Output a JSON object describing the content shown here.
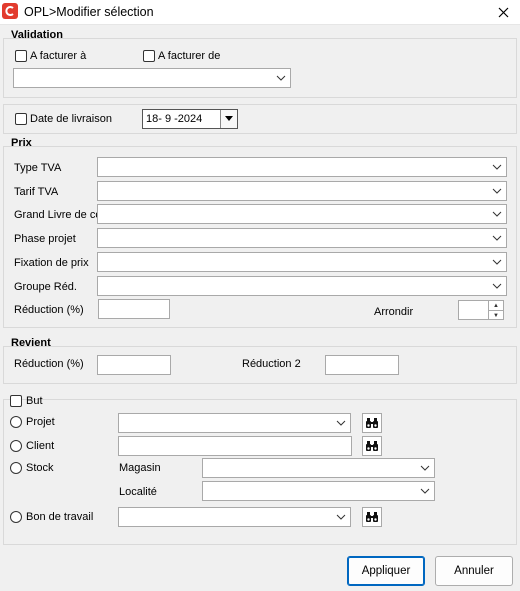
{
  "window": {
    "title": "OPL>Modifier sélection"
  },
  "validation": {
    "title": "Validation",
    "a_facturer_a": "A facturer à",
    "a_facturer_de": "A facturer de",
    "combo_value": ""
  },
  "livraison": {
    "label": "Date de livraison",
    "date_value": "18- 9 -2024"
  },
  "prix": {
    "title": "Prix",
    "rows": [
      {
        "label": "Type TVA",
        "value": ""
      },
      {
        "label": "Tarif TVA",
        "value": ""
      },
      {
        "label": "Grand Livre de co",
        "value": ""
      },
      {
        "label": "Phase projet",
        "value": ""
      },
      {
        "label": "Fixation de prix",
        "value": ""
      },
      {
        "label": "Groupe Réd.",
        "value": ""
      }
    ],
    "reduction_label": "Réduction (%)",
    "reduction_value": "",
    "arrondir_label": "Arrondir",
    "arrondir_value": ""
  },
  "revient": {
    "title": "Revient",
    "reduction_label": "Réduction (%)",
    "reduction_value": "",
    "reduction2_label": "Réduction 2",
    "reduction2_value": ""
  },
  "but": {
    "label": "But",
    "projet": "Projet",
    "client": "Client",
    "stock": "Stock",
    "magasin": "Magasin",
    "localite": "Localité",
    "bon_de_travail": "Bon de travail"
  },
  "buttons": {
    "apply": "Appliquer",
    "cancel": "Annuler"
  },
  "icons": {
    "app": "app-logo-icon",
    "close": "close-icon",
    "search": "binoculars-icon",
    "dropdown": "chevron-down-icon"
  }
}
